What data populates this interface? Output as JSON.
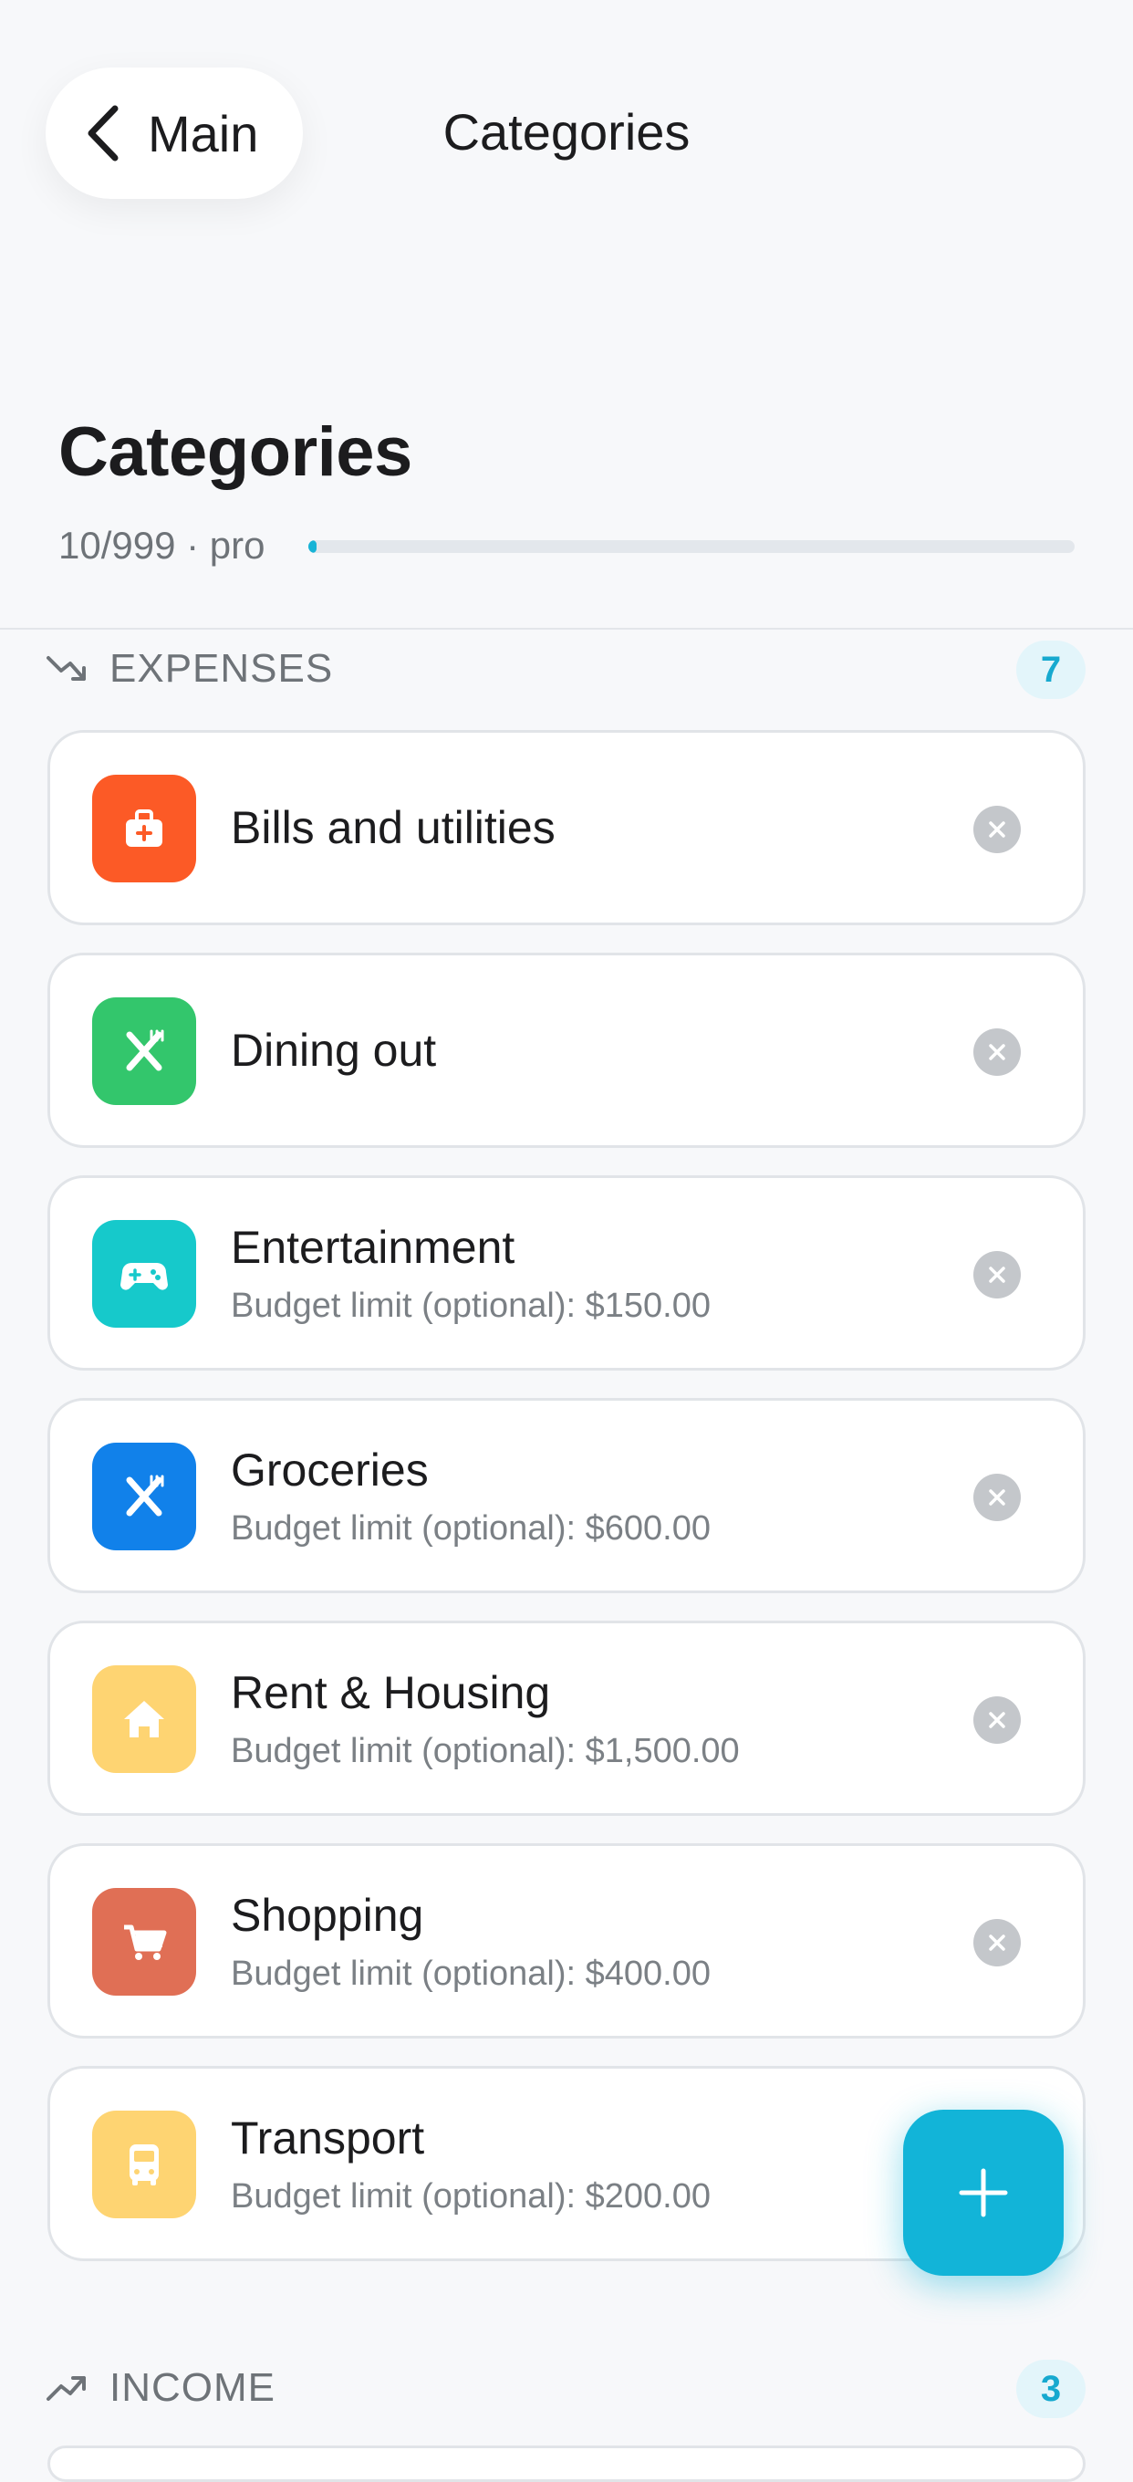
{
  "nav": {
    "back_label": "Main",
    "title": "Categories"
  },
  "header": {
    "title": "Categories",
    "quota_text": "10/999 · pro",
    "quota_used": 10,
    "quota_total": 999
  },
  "expenses": {
    "label": "EXPENSES",
    "count": "7",
    "items": [
      {
        "name": "Bills and utilities",
        "sub": "",
        "icon": "first-aid-kit-icon",
        "color": "#fc5a26"
      },
      {
        "name": "Dining out",
        "sub": "",
        "icon": "fork-knife-icon",
        "color": "#33c66c"
      },
      {
        "name": "Entertainment",
        "sub": "Budget limit (optional): $150.00",
        "icon": "gamepad-icon",
        "color": "#16c9cb"
      },
      {
        "name": "Groceries",
        "sub": "Budget limit (optional): $600.00",
        "icon": "fork-knife-icon",
        "color": "#1181ea"
      },
      {
        "name": "Rent & Housing",
        "sub": "Budget limit (optional): $1,500.00",
        "icon": "house-icon",
        "color": "#fed472"
      },
      {
        "name": "Shopping",
        "sub": "Budget limit (optional): $400.00",
        "icon": "cart-icon",
        "color": "#e06f55"
      },
      {
        "name": "Transport",
        "sub": "Budget limit (optional): $200.00",
        "icon": "bus-icon",
        "color": "#fed472"
      }
    ]
  },
  "income": {
    "label": "INCOME",
    "count": "3"
  },
  "colors": {
    "accent": "#12b4d8",
    "background": "#f7f8fa"
  }
}
